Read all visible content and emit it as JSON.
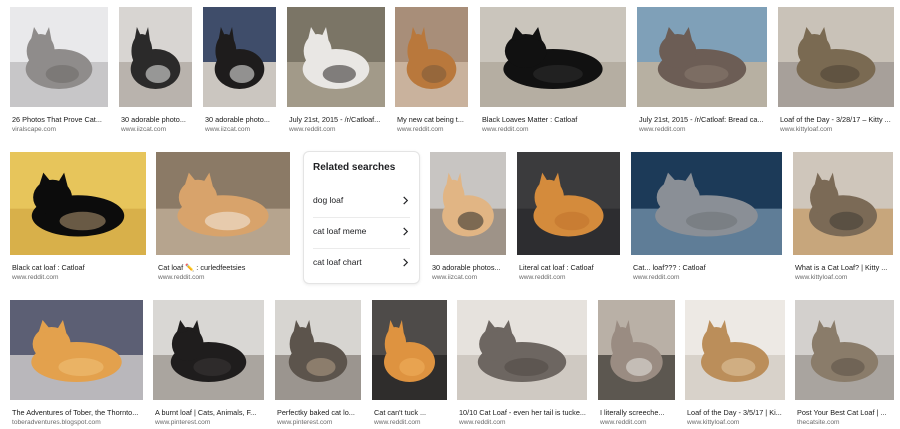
{
  "results": [
    {
      "caption": "26 Photos That Prove Cat...",
      "source": "viralscape.com",
      "palette": [
        "#e9e9eb",
        "#c7c6c8",
        "#8f8c8b",
        "#6e6a67"
      ],
      "icon": "cat-image"
    },
    {
      "caption": "30 adorable photo...",
      "source": "www.iizcat.com",
      "palette": [
        "#d8d5d2",
        "#b9b3ad",
        "#2b2a2a",
        "#f1f0ee"
      ],
      "icon": "cat-image"
    },
    {
      "caption": "30 adorable photo...",
      "source": "www.iizcat.com",
      "palette": [
        "#3f4d6a",
        "#cbc6c0",
        "#1e1c1c",
        "#f2f2f0"
      ],
      "icon": "cat-image"
    },
    {
      "caption": "July 21st, 2015 - /r/Catloaf...",
      "source": "www.reddit.com",
      "palette": [
        "#7b7566",
        "#a29a89",
        "#e9e7e4",
        "#2a2725"
      ],
      "icon": "cat-image"
    },
    {
      "caption": "My new cat being t...",
      "source": "www.reddit.com",
      "palette": [
        "#a88e79",
        "#c9b29d",
        "#b9783c",
        "#7a5a3b"
      ],
      "icon": "cat-image"
    },
    {
      "caption": "Black Loaves Matter : Catloaf",
      "source": "www.reddit.com",
      "palette": [
        "#cac5bc",
        "#b5aea2",
        "#111111",
        "#303030"
      ],
      "icon": "cat-image"
    },
    {
      "caption": "July 21st, 2015 - /r/Catloaf: Bread ca...",
      "source": "www.reddit.com",
      "palette": [
        "#7fa0b8",
        "#b7b0a2",
        "#6c5d55",
        "#8a7a70"
      ],
      "icon": "cat-image"
    },
    {
      "caption": "Loaf of the Day - 3/28/17 – Kitty ...",
      "source": "www.kittyloaf.com",
      "palette": [
        "#c9c2b8",
        "#a7a09a",
        "#7a6a52",
        "#4a3f33"
      ],
      "icon": "cat-image"
    },
    {
      "caption": "Black cat loaf : Catloaf",
      "source": "www.reddit.com",
      "palette": [
        "#e7c55b",
        "#d8b04a",
        "#0c0c0c",
        "#b69a74"
      ],
      "icon": "cat-image"
    },
    {
      "caption": "Cat loaf ✏️ : curledfeetsies",
      "source": "www.reddit.com",
      "palette": [
        "#8b7a66",
        "#b6a48e",
        "#d8a36b",
        "#f4ede4"
      ],
      "icon": "cat-image"
    },
    {
      "caption": "30 adorable photos...",
      "source": "www.iizcat.com",
      "palette": [
        "#c8c5c2",
        "#9e9388",
        "#e1b584",
        "#2a2a2a"
      ],
      "icon": "cat-image"
    },
    {
      "caption": "Literal cat loaf : Catloaf",
      "source": "www.reddit.com",
      "palette": [
        "#3b3b3d",
        "#2d2d30",
        "#d48b3c",
        "#c0732c"
      ],
      "icon": "cat-image"
    },
    {
      "caption": "Cat... loaf??? : Catloaf",
      "source": "www.reddit.com",
      "palette": [
        "#1c3a58",
        "#5f7d97",
        "#8a8f96",
        "#6e7277"
      ],
      "icon": "cat-image"
    },
    {
      "caption": "What is a Cat Loaf? | Kitty ...",
      "source": "www.kittyloaf.com",
      "palette": [
        "#cfc6bb",
        "#c7a67c",
        "#7b6a56",
        "#3f3a34"
      ],
      "icon": "cat-image"
    },
    {
      "caption": "The Adventures of Tober, the Thornto...",
      "source": "toberadventures.blogspot.com",
      "palette": [
        "#5c5f74",
        "#b9b7bb",
        "#e3a14d",
        "#f0c27a"
      ],
      "icon": "cat-image"
    },
    {
      "caption": "A burnt loaf | Cats, Animals, F...",
      "source": "www.pinterest.com",
      "palette": [
        "#d9d7d4",
        "#aaa59f",
        "#1f1d1d",
        "#3a3736"
      ],
      "icon": "cat-image"
    },
    {
      "caption": "Perfectky baked cat lo...",
      "source": "www.pinterest.com",
      "palette": [
        "#d7d5d1",
        "#9b958f",
        "#5c544c",
        "#b59f86"
      ],
      "icon": "cat-image"
    },
    {
      "caption": "Cat can't tuck ...",
      "source": "www.reddit.com",
      "palette": [
        "#4e4b49",
        "#2f2d2c",
        "#de9340",
        "#f0b15d"
      ],
      "icon": "cat-image"
    },
    {
      "caption": "10/10 Cat Loaf - even her tail is tucke...",
      "source": "www.reddit.com",
      "palette": [
        "#e6e2dd",
        "#cfc9c2",
        "#6d6661",
        "#504945"
      ],
      "icon": "cat-image"
    },
    {
      "caption": "I literally screeche...",
      "source": "www.reddit.com",
      "palette": [
        "#b9b0a6",
        "#5c5750",
        "#9a8c82",
        "#e7e5e2"
      ],
      "icon": "cat-image"
    },
    {
      "caption": "Loaf of the Day - 3/5/17 | Ki...",
      "source": "www.kittyloaf.com",
      "palette": [
        "#ede9e4",
        "#d8d2ca",
        "#bb8e5a",
        "#e2c9a4"
      ],
      "icon": "cat-image"
    },
    {
      "caption": "Post Your Best Cat Loaf | ...",
      "source": "thecatsite.com",
      "palette": [
        "#d3d0cd",
        "#a9a49f",
        "#8a7c6a",
        "#5b5045"
      ],
      "icon": "cat-image"
    }
  ],
  "related": {
    "title": "Related searches",
    "items": [
      {
        "label": "dog loaf",
        "icon": "chevron-right-icon"
      },
      {
        "label": "cat loaf meme",
        "icon": "chevron-right-icon"
      },
      {
        "label": "cat loaf chart",
        "icon": "chevron-right-icon"
      }
    ]
  },
  "colors": {
    "caption": "#1a1a1a",
    "source": "#6a6a6a",
    "border": "#e4e4e4"
  }
}
